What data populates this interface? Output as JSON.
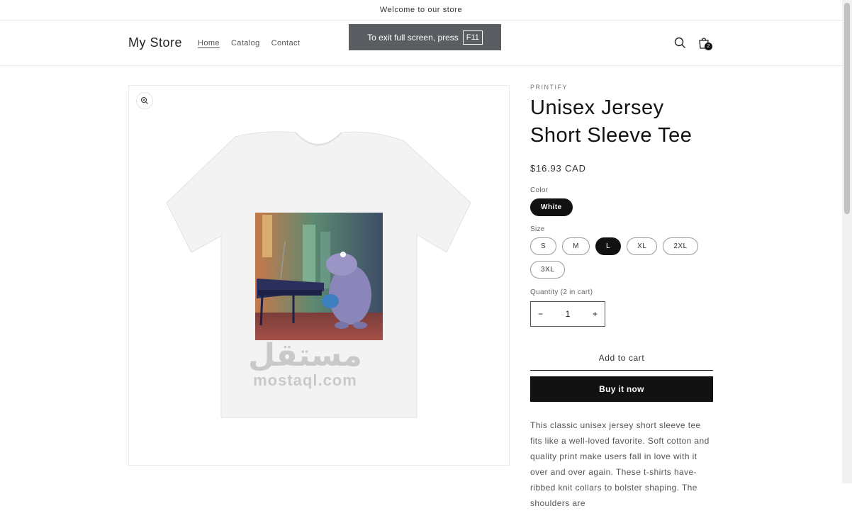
{
  "announcement": "Welcome to our store",
  "header": {
    "logo": "My Store",
    "nav": [
      {
        "label": "Home"
      },
      {
        "label": "Catalog"
      },
      {
        "label": "Contact"
      }
    ],
    "search_icon": "search-icon",
    "cart_icon": "cart-icon",
    "cart_count": "2"
  },
  "fullscreen_toast": {
    "text": "To exit full screen, press",
    "key": "F11"
  },
  "product": {
    "vendor": "PRINTIFY",
    "title": "Unisex Jersey Short Sleeve Tee",
    "price": "$16.93 CAD",
    "color": {
      "label": "Color",
      "options": [
        "White"
      ],
      "selected": "White"
    },
    "size": {
      "label": "Size",
      "options": [
        "S",
        "M",
        "L",
        "XL",
        "2XL",
        "3XL"
      ],
      "selected": "L"
    },
    "quantity": {
      "label": "Quantity (2 in cart)",
      "value": "1",
      "decrement": "−",
      "increment": "+"
    },
    "add_to_cart": "Add to cart",
    "buy_now": "Buy it now",
    "description": "This classic unisex jersey short sleeve tee fits like a well-loved favorite. Soft cotton and quality print make users fall in love with it over and over again. These t-shirts have-ribbed knit collars to bolster shaping. The shoulders are"
  },
  "watermark": {
    "arabic": "مستقل",
    "latin": "mostaql.com"
  },
  "colors": {
    "text": "#121212",
    "button_dark": "#121212",
    "toast_bg": "#5a5d61"
  }
}
